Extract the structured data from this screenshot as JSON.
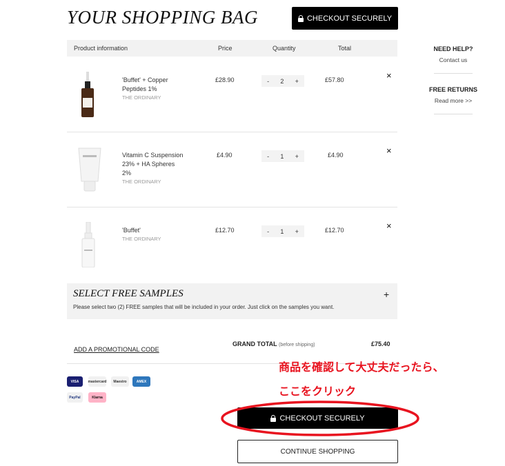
{
  "page": {
    "title": "YOUR SHOPPING BAG"
  },
  "checkout_top": {
    "label": "CHECKOUT SECURELY"
  },
  "table_header": {
    "product": "Product information",
    "price": "Price",
    "quantity": "Quantity",
    "total": "Total"
  },
  "items": [
    {
      "name_line1": "'Buffet' + Copper",
      "name_line2": "Peptides 1%",
      "brand": "THE ORDINARY",
      "price": "£28.90",
      "qty": "2",
      "total": "£57.80",
      "remove": "×",
      "minus": "-",
      "plus": "+"
    },
    {
      "name_line1": "Vitamin C Suspension",
      "name_line2": "23% + HA Spheres 2%",
      "brand": "THE ORDINARY",
      "price": "£4.90",
      "qty": "1",
      "total": "£4.90",
      "remove": "×",
      "minus": "-",
      "plus": "+"
    },
    {
      "name_line1": "'Buffet'",
      "name_line2": "",
      "brand": "THE ORDINARY",
      "price": "£12.70",
      "qty": "1",
      "total": "£12.70",
      "remove": "×",
      "minus": "-",
      "plus": "+"
    }
  ],
  "samples": {
    "title": "SELECT FREE SAMPLES",
    "desc": "Please select two (2) FREE samples that will be included in your order. Just click on the samples you want.",
    "plus": "+"
  },
  "summary": {
    "promo": "ADD A PROMOTIONAL CODE",
    "grand_total_label": "GRAND TOTAL",
    "grand_total_note": "(before shipping)",
    "grand_total_value": "£75.40"
  },
  "sidebar": {
    "help_title": "NEED HELP?",
    "help_link": "Contact us",
    "returns_title": "FREE RETURNS",
    "returns_link": "Read more >>"
  },
  "payments": [
    {
      "name": "VISA",
      "bg": "#1a1f71",
      "fg": "#ffffff"
    },
    {
      "name": "mastercard",
      "bg": "#f1f1f1",
      "fg": "#333333"
    },
    {
      "name": "Maestro",
      "bg": "#f1f1f1",
      "fg": "#333333"
    },
    {
      "name": "AMEX",
      "bg": "#2e77bc",
      "fg": "#ffffff"
    },
    {
      "name": "PayPal",
      "bg": "#f1f1f1",
      "fg": "#253b80"
    },
    {
      "name": "Klarna",
      "bg": "#ffb3c7",
      "fg": "#111111"
    }
  ],
  "annotation": {
    "line1": "商品を確認して大丈夫だったら、",
    "line2": "ここをクリック",
    "color": "#e8131f"
  },
  "checkout_bottom": {
    "label": "CHECKOUT SECURELY"
  },
  "continue": {
    "label": "CONTINUE SHOPPING"
  }
}
